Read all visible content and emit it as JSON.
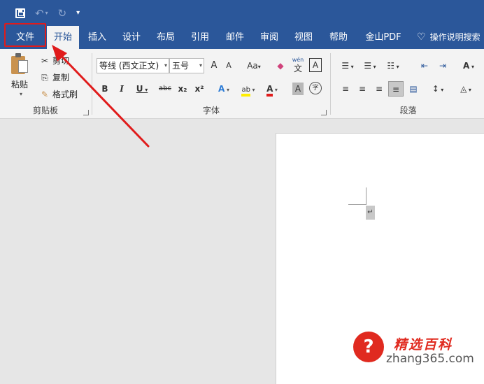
{
  "quick_access": {
    "save_icon": "save-icon",
    "undo_icon": "undo-icon",
    "redo_icon": "redo-icon",
    "customize": "▾"
  },
  "tabs": [
    "文件",
    "开始",
    "插入",
    "设计",
    "布局",
    "引用",
    "邮件",
    "审阅",
    "视图",
    "帮助",
    "金山PDF"
  ],
  "tell_me": "操作说明搜索",
  "clipboard": {
    "paste": "粘贴",
    "cut": "剪切",
    "copy": "复制",
    "format_painter": "格式刷",
    "label": "剪贴板"
  },
  "font": {
    "font_name": "等线 (西文正文)",
    "font_size": "五号",
    "grow": "A",
    "shrink": "A",
    "change_case": "Aa",
    "phonetic_top": "wén",
    "phonetic_char": "文",
    "char_border": "A",
    "bold": "B",
    "italic": "I",
    "underline": "U",
    "strikethrough": "abc",
    "subscript": "x₂",
    "superscript": "x²",
    "text_effects": "A",
    "highlight": "ab",
    "font_color": "A",
    "char_shading": "A",
    "enclose": "字",
    "label": "字体"
  },
  "paragraph": {
    "label": "段落"
  },
  "watermark": {
    "title": "精选百科",
    "url": "zhang365.com",
    "logo_char": "?"
  },
  "colors": {
    "brand": "#2b579a",
    "highlight_box": "#e01b1b",
    "arrow": "#e01b1b"
  }
}
